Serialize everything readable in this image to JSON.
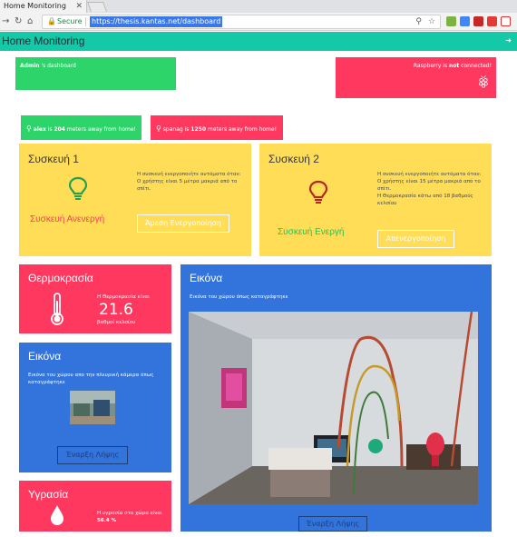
{
  "browser": {
    "tab_title": "Home Monitoring",
    "tab_close": "✕",
    "secure_label": "Secure",
    "url": "https://thesis.kantas.net/dashboard"
  },
  "app": {
    "title": "Home Monitoring",
    "logout_icon": "logout-icon",
    "accent": "#14c9a7"
  },
  "dashboard_card": {
    "user": "Admin",
    "suffix": " 's dashboard"
  },
  "raspberry_card": {
    "prefix": "Raspberry is ",
    "status": "not",
    "suffix": " connected!"
  },
  "distances": [
    {
      "user": "alex",
      "mid": " is ",
      "meters": "204",
      "suffix": " meters away from home!"
    },
    {
      "user": "spanag",
      "mid": " is ",
      "meters": "1250",
      "suffix": " meters away from home!"
    }
  ],
  "devices": [
    {
      "title": "Συσκευή 1",
      "status": "Συσκευή Ανενεργή",
      "status_color": "#ff3860",
      "bulb_color": "#23a050",
      "lines": [
        "Η συσκευή ενεργοποιήτε αυτόματα όταν:",
        "Ο χρήστης είναι 5 μέτρα μακριά από το σπίτι."
      ],
      "button": "Άμεση Ενεργοποίηση"
    },
    {
      "title": "Συσκευή 2",
      "status": "Συσκευή Ενεργή",
      "status_color": "#23c15a",
      "bulb_color": "#b3261e",
      "lines": [
        "Η συσκευή ενεργοποιήτε αυτόματα όταν:",
        "Ο χρήστης είναι 15 μέτρα μακριά από το σπίτι.",
        "Η Θερμοκρασία κάτω από 18 βαθμούς κελσίου"
      ],
      "button": "Απενεργοποίηση"
    }
  ],
  "temperature": {
    "title": "Θερμοκρασία",
    "label": "Η Θερμοκρασία είναι",
    "value": "21.6",
    "unit": "βαθμοί κελσίου"
  },
  "image_small": {
    "title": "Εικόνα",
    "desc": "Εικόνα του χώρου απο την πλευρική κάμερα όπως καταγράφτηκε",
    "button": "Έναρξη Λήψης"
  },
  "humidity": {
    "title": "Υγρασία",
    "label": "Η υγρασία στο χώρο είναι",
    "value": "56.4 %"
  },
  "image_large": {
    "title": "Εικόνα",
    "desc": "Εικόνα του χώρου όπως καταγράφτηκε",
    "button": "Έναρξη Λήψης"
  }
}
